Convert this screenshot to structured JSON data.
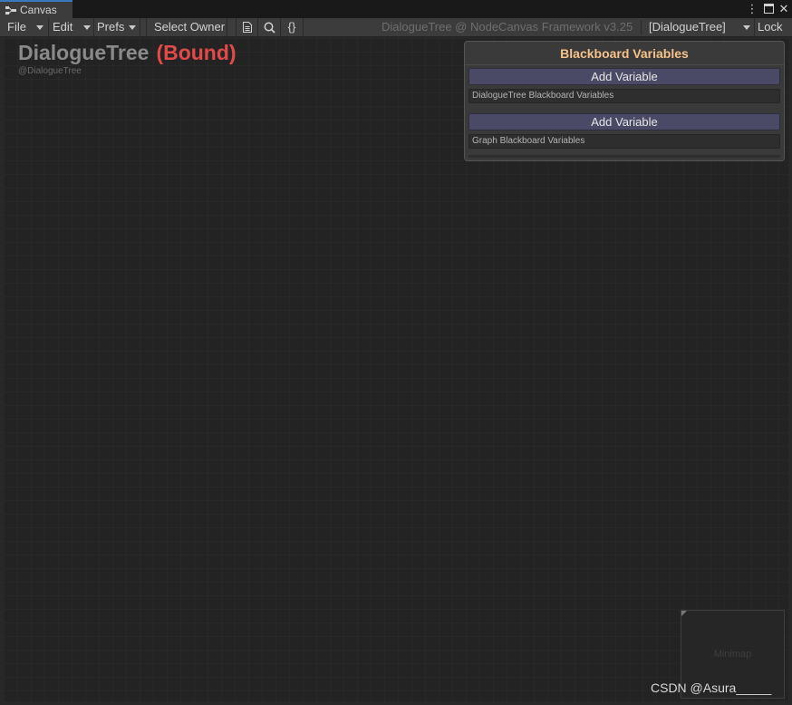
{
  "tab": {
    "label": "Canvas",
    "icon": "graph-node-icon"
  },
  "window_controls": {
    "more": "⋮",
    "maximize": "□",
    "close": "✕"
  },
  "toolbar": {
    "file": "File",
    "edit": "Edit",
    "prefs": "Prefs",
    "select_owner": "Select Owner",
    "icons": [
      "document-icon",
      "search-icon",
      "braces-icon"
    ],
    "braces_glyph": "{}",
    "title": "DialogueTree @ NodeCanvas Framework v3.25",
    "graph_selector": "[DialogueTree]",
    "lock": "Lock"
  },
  "graph": {
    "name": "DialogueTree",
    "bound_label": "(Bound)",
    "owner": "@DialogueTree"
  },
  "blackboard": {
    "title": "Blackboard Variables",
    "sections": [
      {
        "add_label": "Add Variable",
        "name": "DialogueTree Blackboard Variables"
      },
      {
        "add_label": "Add Variable",
        "name": "Graph Blackboard Variables"
      }
    ]
  },
  "minimap": {
    "label": "Minimap"
  },
  "watermark": "CSDN @Asura_____",
  "colors": {
    "accent_tab": "#3a79bb",
    "bound": "#e24a4a",
    "blackboard_title": "#f5c38a",
    "add_variable_bg": "#4a4a66"
  }
}
